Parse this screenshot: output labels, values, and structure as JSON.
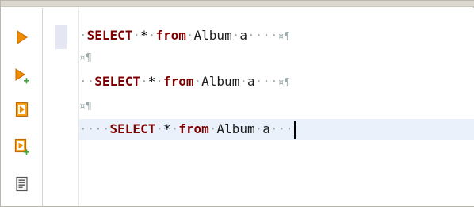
{
  "toolbar": {
    "items": [
      {
        "name": "execute-icon",
        "color": "#f08c00"
      },
      {
        "name": "execute-new-tab-icon",
        "color": "#f08c00"
      },
      {
        "name": "execute-script-icon",
        "color": "#f08c00"
      },
      {
        "name": "execute-script-new-tab-icon",
        "color": "#f08c00"
      },
      {
        "name": "history-icon",
        "color": "#555555"
      }
    ]
  },
  "editor": {
    "lines": [
      {
        "indent": "·",
        "kw1": "SELECT",
        "sp1": "·",
        "star": "*",
        "sp2": "·",
        "kw2": "from",
        "sp3": "·",
        "table": "Album",
        "sp4": "·",
        "alias": "a",
        "trail": "····",
        "eol": "¤¶"
      },
      {
        "eol": "¤¶"
      },
      {
        "indent": "··",
        "kw1": "SELECT",
        "sp1": "·",
        "star": "*",
        "sp2": "·",
        "kw2": "from",
        "sp3": "·",
        "table": "Album",
        "sp4": "·",
        "alias": "a",
        "trail": "···",
        "eol": "¤¶"
      },
      {
        "eol": "¤¶"
      },
      {
        "indent": "····",
        "kw1": "SELECT",
        "sp1": "·",
        "star": "*",
        "sp2": "·",
        "kw2": "from",
        "sp3": "·",
        "table": "Album",
        "sp4": "·",
        "alias": "a",
        "trail": "···",
        "eol": ""
      }
    ],
    "colors": {
      "keyword": "#7f0000",
      "whitespace_marker": "#9aa9a9",
      "current_line": "#eaf1fb"
    }
  }
}
